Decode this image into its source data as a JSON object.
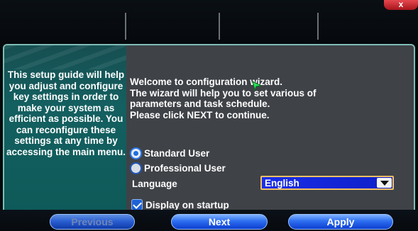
{
  "window": {
    "close_label": "x"
  },
  "guide": {
    "text": "This setup guide will help you adjust and configure key settings in order to make your system as efficient as possible. You can reconfigure these settings at any time by accessing the main menu."
  },
  "welcome": {
    "lines": [
      "Welcome to configuration wizard.",
      "The wizard will help you to set various of",
      "parameters and task schedule.",
      "Please click NEXT to continue."
    ]
  },
  "user_type": {
    "options": [
      {
        "label": "Standard User",
        "selected": true
      },
      {
        "label": "Professional User",
        "selected": false
      }
    ]
  },
  "language": {
    "label": "Language",
    "value": "English"
  },
  "startup": {
    "label": "Display on startup",
    "checked": true
  },
  "buttons": {
    "previous": "Previous",
    "next": "Next",
    "apply": "Apply"
  }
}
